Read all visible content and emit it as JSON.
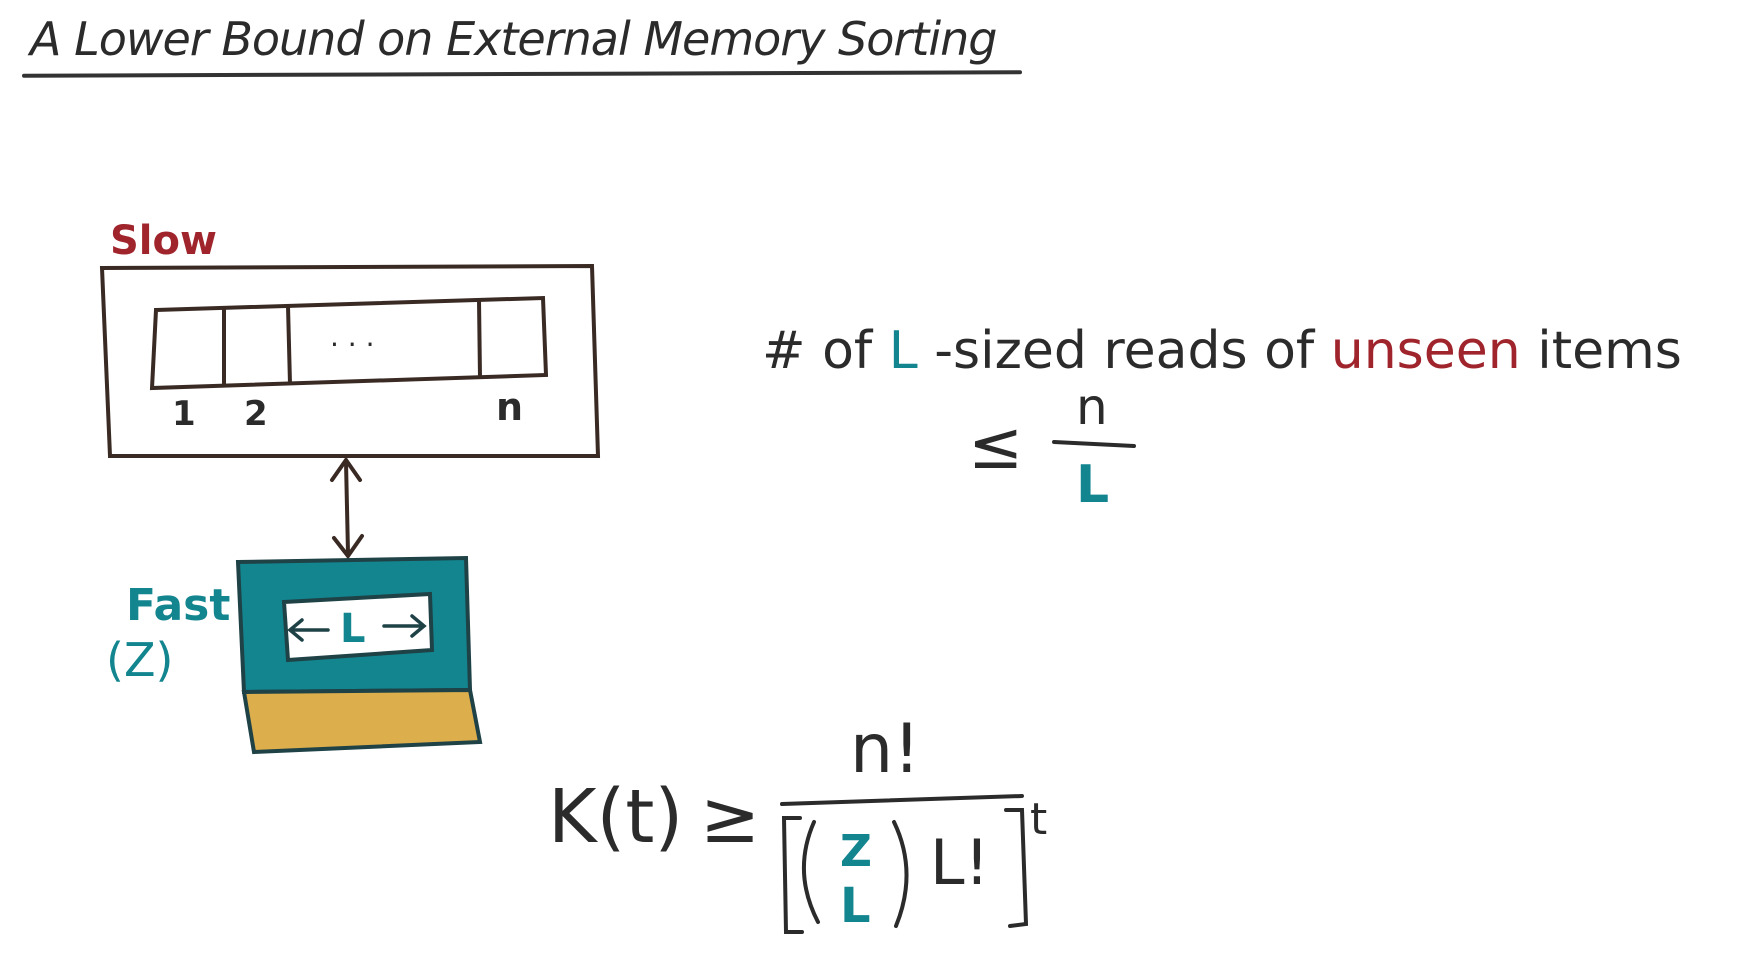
{
  "title": "A Lower Bound on External Memory Sorting",
  "slow_memory": {
    "label": "Slow",
    "ellipsis": "· · ·",
    "cell_labels": [
      "1",
      "2",
      "n"
    ]
  },
  "fast_memory": {
    "label": "Fast",
    "size_label": "(Z)",
    "block_label": "L"
  },
  "reads_statement": {
    "prefix": "# of ",
    "L": "L",
    "middle": "-sized reads of ",
    "unseen": "unseen",
    "suffix": " items",
    "relation": "≤",
    "numerator": "n",
    "denominator": "L"
  },
  "bound": {
    "lhs": "K(t)",
    "relation": "≥",
    "numerator": "n!",
    "binom_top": "Z",
    "binom_bottom": "L",
    "factorial": "L!",
    "exponent": "t"
  },
  "colors": {
    "ink": "#2b2b2b",
    "box_outline": "#3a2a24",
    "teal": "#12858f",
    "red": "#a0242c",
    "gold": "#dcae4c"
  }
}
